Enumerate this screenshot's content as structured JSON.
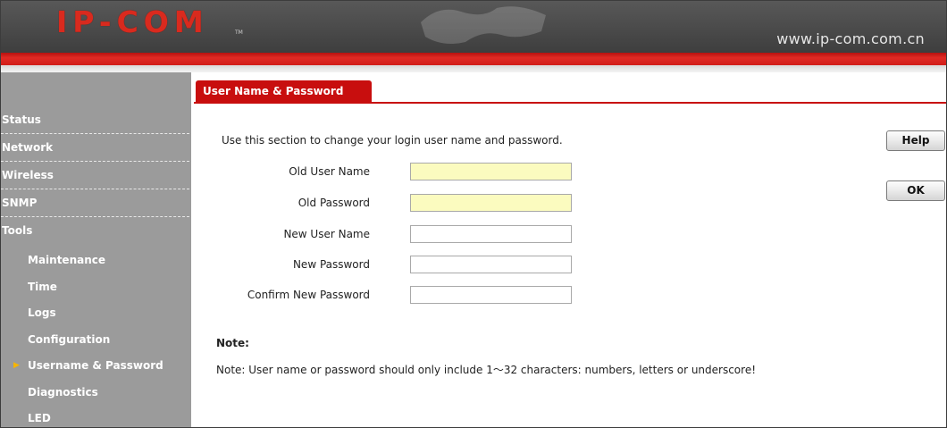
{
  "header": {
    "logo": "IP-COM",
    "logo_mark": "TM",
    "url": "www.ip-com.com.cn"
  },
  "sidebar": {
    "items": [
      {
        "label": "Status"
      },
      {
        "label": "Network"
      },
      {
        "label": "Wireless"
      },
      {
        "label": "SNMP"
      },
      {
        "label": "Tools"
      }
    ],
    "subitems": [
      {
        "label": "Maintenance"
      },
      {
        "label": "Time"
      },
      {
        "label": "Logs"
      },
      {
        "label": "Configuration"
      },
      {
        "label": "Username & Password",
        "active": true
      },
      {
        "label": "Diagnostics"
      },
      {
        "label": "LED"
      }
    ],
    "active_marker": "▶"
  },
  "main": {
    "tab": "User Name & Password",
    "intro": "Use this section to change your login user name and password.",
    "fields": [
      {
        "label": "Old User Name",
        "value": "",
        "highlight": true
      },
      {
        "label": "Old Password",
        "value": "",
        "highlight": true
      },
      {
        "label": "New User Name",
        "value": ""
      },
      {
        "label": "New Password",
        "value": ""
      },
      {
        "label": "Confirm New Password",
        "value": ""
      }
    ],
    "note_title": "Note:",
    "note_text": "Note: User name or password should only include 1～32 characters: numbers, letters or underscore!"
  },
  "buttons": {
    "help": "Help",
    "ok": "OK"
  },
  "colors": {
    "accent_red": "#c80e0e",
    "sidebar_bg": "#9b9b9b",
    "header_bg": "#4a4a4a",
    "input_highlight": "#fbfbbf"
  }
}
